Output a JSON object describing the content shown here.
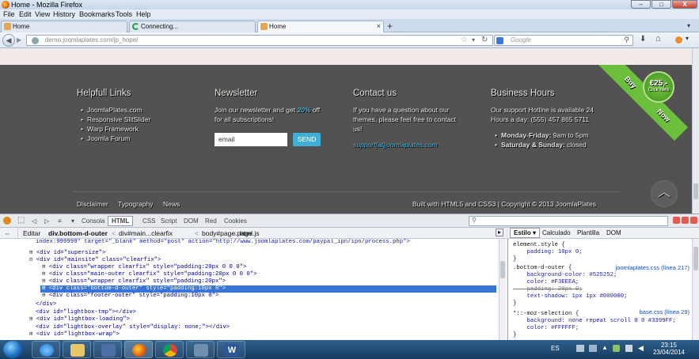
{
  "window": {
    "title": "Home - Mozilla Firefox",
    "min": "–",
    "max": "□",
    "close": "X"
  },
  "menu": [
    "File",
    "Edit",
    "View",
    "History",
    "Bookmarks",
    "Tools",
    "Help"
  ],
  "tabs": [
    {
      "label": "Home"
    },
    {
      "label": "Connecting..."
    },
    {
      "label": "Home"
    }
  ],
  "new_tab": "+",
  "nav": {
    "url": "demo.joomlaplates.com/jp_hope/",
    "search_placeholder": "Google"
  },
  "footer": {
    "col1": {
      "title": "Helpfull Links",
      "links": [
        "JoomlaPlates.com",
        "Responsive SlitSlider",
        "Warp Framework",
        "Joomla Forum"
      ]
    },
    "col2": {
      "title": "Newsletter",
      "text1": "Join our newsletter and get ",
      "percent": "20%",
      "text2": " off",
      "text3": "for all subscriptions!",
      "email_placeholder": "email",
      "send": "SEND"
    },
    "col3": {
      "title": "Contact us",
      "text1": "If you have a question about our",
      "text2": "themes, please feel free to contact",
      "text3": "us!",
      "email": "support[at]joomlaplates.com"
    },
    "col4": {
      "title": "Business Hours",
      "text1": "Our support Hotline is available 24",
      "text2": "Hours a day: (555) 457 865 5711",
      "h1_day": "Monday-Friday:",
      "h1_time": " 9am to 5pm",
      "h2_day": "Saturday & Sunday:",
      "h2_time": " closed"
    },
    "bottom_links": [
      "Disclaimer",
      "Typography",
      "News"
    ],
    "copyright": "Built with HTML5 and CSS3 | Copyright © 2013 JoomlaPlates",
    "ribbon_buy": "Buy",
    "ribbon_now": "Now",
    "seal_price": "€25,-",
    "seal_sub": "Click here"
  },
  "devtools": {
    "tabs": [
      "Consola",
      "HTML",
      "CSS",
      "Script",
      "DOM",
      "Red",
      "Cookies"
    ],
    "edit": "Editar",
    "breadcrumb": [
      "div.bottom-d-outer",
      "div#main...clearfix",
      "body#page.page",
      "html.js"
    ],
    "css_tabs": [
      "Estilo",
      "Calculado",
      "Plantilla",
      "DOM"
    ],
    "html_lines": [
      "index:999999\" target=\"_blank\" method=\"post\" action=\"http://www.joomlaplates.com/paypal_ipn/ipn/process.php\">",
      "<div id=\"supersize\">",
      "<div id=\"mainsite\" class=\"clearfix\">",
      "<div class=\"wrapper clearfix\" style=\"padding:20px 0 0 0\">",
      "<div class=\"main-outer clearfix\" style=\"padding:20px 0 0 0\">",
      "<div class=\"wrapper clearfix\" style=\"padding:20px\">",
      "<div class=\"bottom-d-outer\" style=\"padding:10px 0\">",
      "<div class=\"footer-outer\" style=\"padding:10px 0\">",
      "</div>",
      "<div id=\"lightbox-tmp\"></div>",
      "<div id=\"lightbox-loading\">",
      "<div id=\"lightbox-overlay\" style=\"display: none;\"></div>",
      "<div id=\"lightbox-wrap\">"
    ],
    "css_lines": [
      "element.style {",
      "    padding: 10px 0;",
      "}",
      ".bottom-d-outer {",
      "    background-color: #525252;",
      "    color: #F3EEEA;",
      "    padding: 20px 0;",
      "    text-shadow: 1px 1px #000000;",
      "}",
      "*::-moz-selection {",
      "    background: none repeat scroll 0 0 #3399FF;",
      "    color: #FFFFFF;",
      "}"
    ],
    "src1": "joomlaplates.css (línea 217)",
    "src2": "base.css (línea 29)"
  },
  "taskbar": {
    "lang": "ES",
    "time": "23:15",
    "date": "23/04/2014"
  },
  "colors": {
    "footer_bg": "#525252",
    "accent": "#3eb0d6",
    "selection": "#3875d7"
  }
}
